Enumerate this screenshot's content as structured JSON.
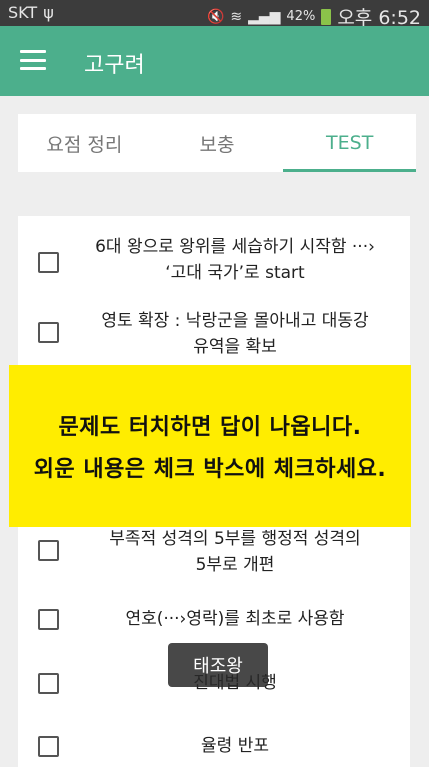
{
  "status_bar": {
    "carrier": "SKT",
    "usb_glyph": "ψ",
    "battery_percent": "42%",
    "time": "오후 6:52"
  },
  "app_bar": {
    "title": "고구려"
  },
  "tabs": [
    {
      "label": "요점 정리",
      "active": false
    },
    {
      "label": "보충",
      "active": false
    },
    {
      "label": "TEST",
      "active": true
    }
  ],
  "items": [
    {
      "text_line1": "6대 왕으로 왕위를 세습하기 시작함 ···›",
      "text_line2": "‘고대 국가’로 start",
      "checked": false
    },
    {
      "text_line1": "영토 확장 : 낙랑군을 몰아내고 대동강",
      "text_line2": "유역을 확보",
      "checked": false
    },
    {
      "text_line1": "부족적 성격의 5부를 행정적 성격의",
      "text_line2": "5부로 개편",
      "checked": false
    },
    {
      "text_line1": "연호(···›영락)를 최초로 사용함",
      "text_line2": "",
      "checked": false
    },
    {
      "text_line1": "진대법 시행",
      "text_line2": "",
      "checked": false
    },
    {
      "text_line1": "율령 반포",
      "text_line2": "",
      "checked": false
    }
  ],
  "overlay": {
    "line1": "문제도 터치하면 답이 나옵니다.",
    "line2": "외운 내용은 체크 박스에 체크하세요."
  },
  "toast": {
    "text": "태조왕"
  },
  "colors": {
    "accent": "#4caf8c",
    "overlay_bg": "#ffed00",
    "status_bar_bg": "#3c3c3c"
  }
}
